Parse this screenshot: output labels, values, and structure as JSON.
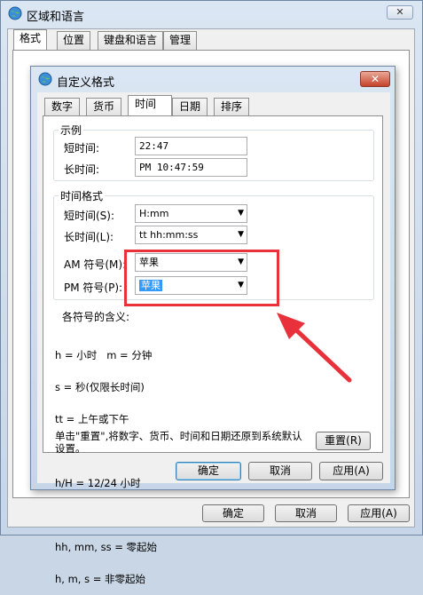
{
  "outer": {
    "title": "区域和语言",
    "close": "✕",
    "tabs": [
      "格式",
      "位置",
      "键盘和语言",
      "管理"
    ],
    "buttons": {
      "ok": "确定",
      "cancel": "取消",
      "apply": "应用(A)"
    }
  },
  "inner": {
    "title": "自定义格式",
    "close": "✕",
    "tabs": [
      "数字",
      "货币",
      "时间",
      "日期",
      "排序"
    ],
    "example": {
      "group_title": "示例",
      "short_label": "短时间:",
      "short_value": "22:47",
      "long_label": "长时间:",
      "long_value": "PM 10:47:59"
    },
    "formats": {
      "group_title": "时间格式",
      "short_label": "短时间(S):",
      "short_value": "H:mm",
      "long_label": "长时间(L):",
      "long_value": "tt hh:mm:ss",
      "am_label": "AM 符号(M):",
      "am_value": "苹果",
      "pm_label": "PM 符号(P):",
      "pm_value": "苹果"
    },
    "meaning_title": "各符号的含义:",
    "meaning_lines": [
      "h = 小时   m = 分钟",
      "s = 秒(仅限长时间)",
      "tt = 上午或下午",
      "",
      "h/H = 12/24 小时",
      "",
      "hh, mm, ss = 零起始",
      "h, m, s = 非零起始"
    ],
    "reset_text": "单击\"重置\",将数字、货币、时间和日期还原到系统默认设置。",
    "reset_button": "重置(R)",
    "buttons": {
      "ok": "确定",
      "cancel": "取消",
      "apply": "应用(A)"
    }
  },
  "annotation_color": "#e8313a"
}
